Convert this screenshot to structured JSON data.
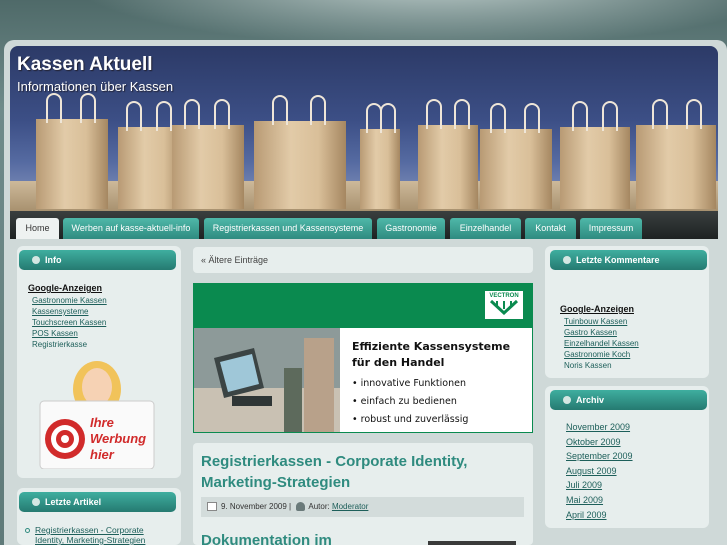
{
  "site": {
    "title": "Kassen Aktuell",
    "description": "Informationen über Kassen"
  },
  "nav": [
    {
      "label": "Home",
      "active": true
    },
    {
      "label": "Werben auf kasse-aktuell-info"
    },
    {
      "label": "Registrierkassen und Kassensysteme"
    },
    {
      "label": "Gastronomie"
    },
    {
      "label": "Einzelhandel"
    },
    {
      "label": "Kontakt"
    },
    {
      "label": "Impressum"
    }
  ],
  "left": {
    "info": {
      "heading": "Info",
      "ads_title": "Google-Anzeigen",
      "ads": [
        "Gastronomie Kassen",
        "Kassensysteme",
        "Touchscreen Kassen",
        "POS Kassen",
        "Registrierkasse"
      ],
      "promo": {
        "line1": "Ihre",
        "line2": "Werbung",
        "line3": "hier"
      }
    },
    "latest": {
      "heading": "Letzte Artikel",
      "items": [
        "Registrierkassen - Corporate",
        "Identity, Marketing-Strategien"
      ]
    }
  },
  "main": {
    "older_link": "« Ältere Einträge",
    "banner": {
      "brand": "VECTRON",
      "headline1": "Effiziente Kassensysteme",
      "headline2": "für den Handel",
      "bullets": [
        "• innovative Funktionen",
        "• einfach zu bedienen",
        "• robust und zuverlässig"
      ]
    },
    "post": {
      "title1": "Registrierkassen - Corporate Identity,",
      "title2": "Marketing-Strategien",
      "date": "9. November 2009 |",
      "author_label": "Autor:",
      "author": "Moderator"
    },
    "next_post_title": "Dokumentation im"
  },
  "right": {
    "comments": {
      "heading": "Letzte Kommentare",
      "ads_title": "Google-Anzeigen",
      "ads": [
        "Tuinbouw Kassen",
        "Gastro Kassen",
        "Einzelhandel Kassen",
        "Gastronomie Koch",
        "Noris Kassen"
      ]
    },
    "archive": {
      "heading": "Archiv",
      "months": [
        "November 2009",
        "Oktober 2009",
        "September 2009",
        "August 2009",
        "Juli 2009",
        "Mai 2009",
        "April 2009"
      ]
    }
  },
  "colors": {
    "accent": "#2f8b7f",
    "banner_green": "#0a8a4f",
    "nav_tab": "#3fae9f"
  }
}
